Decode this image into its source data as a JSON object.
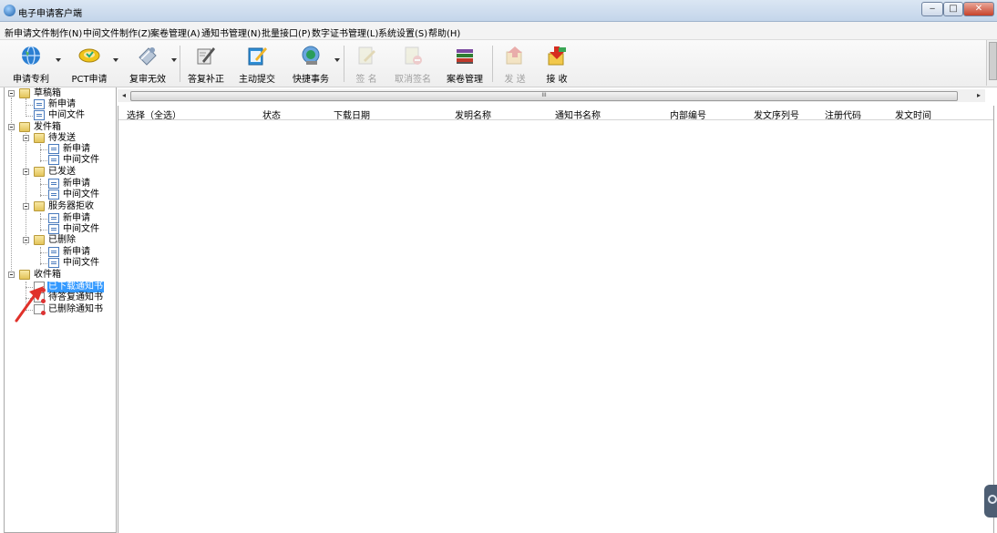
{
  "window": {
    "title": "电子申请客户端",
    "controls": {
      "minimize": "‒",
      "maximize": "□",
      "close": "✕"
    }
  },
  "menu": [
    "新申请文件制作(N)",
    "中间文件制作(Z)",
    "案卷管理(A)",
    "通知书管理(N)",
    "批量接口(P)",
    "数字证书管理(L)",
    "系统设置(S)",
    "帮助(H)"
  ],
  "toolbar": [
    {
      "label": "申请专利",
      "icon": "globe-icon",
      "enabled": true,
      "has_dropdown": true
    },
    {
      "label": "PCT申请",
      "icon": "pct-disk-icon",
      "enabled": true,
      "has_dropdown": true
    },
    {
      "label": "复审无效",
      "icon": "review-icon",
      "enabled": true,
      "has_dropdown": true
    },
    {
      "label": "答复补正",
      "icon": "pen-reply-icon",
      "enabled": true,
      "has_dropdown": false
    },
    {
      "label": "主动提交",
      "icon": "submit-notepad-icon",
      "enabled": true,
      "has_dropdown": false
    },
    {
      "label": "快捷事务",
      "icon": "quick-task-icon",
      "enabled": true,
      "has_dropdown": true
    },
    {
      "label": "签 名",
      "icon": "sign-icon",
      "enabled": false,
      "has_dropdown": false
    },
    {
      "label": "取消签名",
      "icon": "cancel-sign-icon",
      "enabled": false,
      "has_dropdown": false
    },
    {
      "label": "案卷管理",
      "icon": "books-icon",
      "enabled": true,
      "has_dropdown": false
    },
    {
      "label": "发 送",
      "icon": "send-icon",
      "enabled": false,
      "has_dropdown": false
    },
    {
      "label": "接 收",
      "icon": "receive-icon",
      "enabled": true,
      "has_dropdown": false
    }
  ],
  "tree": {
    "drafts": {
      "label": "草稿箱",
      "children": {
        "new": "新申请",
        "middle": "中间文件"
      }
    },
    "outbox": {
      "label": "发件箱",
      "pending": {
        "label": "待发送",
        "new": "新申请",
        "middle": "中间文件"
      },
      "sent": {
        "label": "已发送",
        "new": "新申请",
        "middle": "中间文件"
      },
      "rejected": {
        "label": "服务器拒收",
        "new": "新申请",
        "middle": "中间文件"
      },
      "deleted": {
        "label": "已删除",
        "new": "新申请",
        "middle": "中间文件"
      }
    },
    "inbox": {
      "label": "收件箱",
      "downloaded": "已下载通知书",
      "to_reply": "待答复通知书",
      "deleted": "已删除通知书"
    },
    "selected": "已下载通知书"
  },
  "list": {
    "columns": [
      "选择（全选）",
      "状态",
      "下载日期",
      "发明名称",
      "通知书名称",
      "内部编号",
      "发文序列号",
      "注册代码",
      "发文时间"
    ],
    "rows": []
  },
  "hscroll": {
    "grip": "III",
    "left": "◂",
    "right": "▸"
  }
}
